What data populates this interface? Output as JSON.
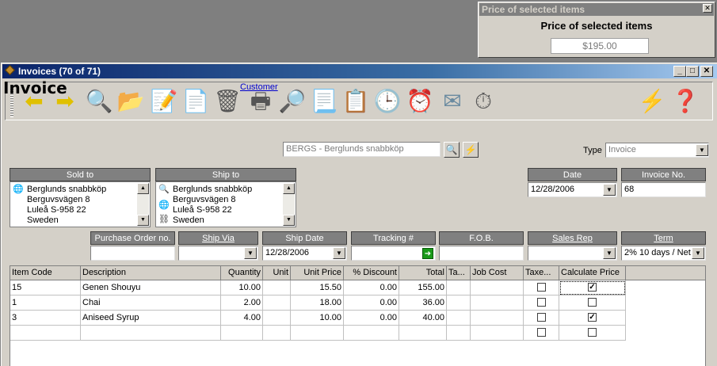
{
  "price_popup": {
    "title": "Price of selected items",
    "heading": "Price of selected items",
    "value": "$195.00"
  },
  "window": {
    "title": "Invoices (70 of 71)"
  },
  "toolbar": {
    "icons": [
      "back-arrow-icon",
      "forward-arrow-icon",
      "magnifier-icon",
      "folder-icon",
      "edit-document-icon",
      "new-document-icon",
      "trash-icon",
      "print-icon",
      "print-preview-icon",
      "highlight-document-icon",
      "delete-document-icon",
      "clock-icon",
      "reminder-clock-icon",
      "email-icon",
      "stopwatch-icon",
      "sync-icon",
      "help-icon"
    ]
  },
  "header": {
    "title": "Invoice",
    "customer_label": "Customer",
    "customer_value": "BERGS - Berglunds snabbköp",
    "type_label": "Type",
    "type_value": "Invoice"
  },
  "sold_to": {
    "label": "Sold to",
    "lines": [
      "Berglunds snabbköp",
      "Berguvsvägen  8",
      "Luleå  S-958 22",
      "Sweden"
    ]
  },
  "ship_to": {
    "label": "Ship to",
    "lines": [
      "Berglunds snabbköp",
      "Berguvsvägen  8",
      "Luleå  S-958 22",
      "Sweden"
    ]
  },
  "date": {
    "label": "Date",
    "value": "12/28/2006"
  },
  "invoice_no": {
    "label": "Invoice No.",
    "value": "68"
  },
  "fields": {
    "po_label": "Purchase Order no.",
    "po_value": "",
    "ship_via_label": "Ship Via",
    "ship_via_value": "",
    "ship_date_label": "Ship Date",
    "ship_date_value": "12/28/2006",
    "tracking_label": "Tracking #",
    "tracking_value": "",
    "fob_label": "F.O.B.",
    "fob_value": "",
    "sales_rep_label": "Sales Rep",
    "sales_rep_value": "",
    "term_label": "Term",
    "term_value": "2% 10 days / Net"
  },
  "grid": {
    "columns": [
      "Item Code",
      "Description",
      "Quantity",
      "Unit",
      "Unit Price",
      "% Discount",
      "Total",
      "Ta...",
      "Job Cost",
      "Taxe...",
      "Calculate Price"
    ],
    "rows": [
      {
        "item_code": "15",
        "description": "Genen Shouyu",
        "quantity": "10.00",
        "unit": "",
        "unit_price": "15.50",
        "discount": "0.00",
        "total": "155.00",
        "tax": "",
        "job_cost": "",
        "taxed": false,
        "calc": true
      },
      {
        "item_code": "1",
        "description": "Chai",
        "quantity": "2.00",
        "unit": "",
        "unit_price": "18.00",
        "discount": "0.00",
        "total": "36.00",
        "tax": "",
        "job_cost": "",
        "taxed": false,
        "calc": false
      },
      {
        "item_code": "3",
        "description": "Aniseed Syrup",
        "quantity": "4.00",
        "unit": "",
        "unit_price": "10.00",
        "discount": "0.00",
        "total": "40.00",
        "tax": "",
        "job_cost": "",
        "taxed": false,
        "calc": true
      },
      {
        "item_code": "",
        "description": "",
        "quantity": "",
        "unit": "",
        "unit_price": "",
        "discount": "",
        "total": "",
        "tax": "",
        "job_cost": "",
        "taxed": false,
        "calc": false
      }
    ]
  }
}
